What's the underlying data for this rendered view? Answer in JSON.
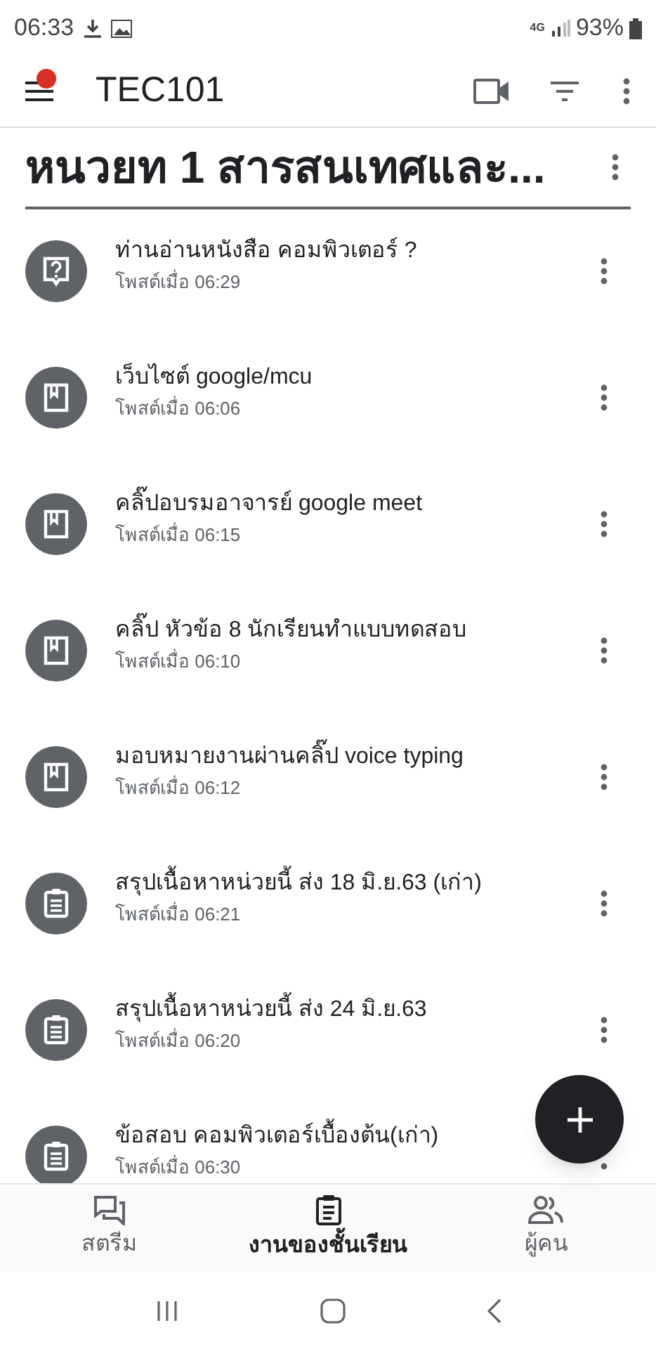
{
  "status_bar": {
    "time": "06:33",
    "network": "4G",
    "battery": "93%"
  },
  "app_bar": {
    "title": "TEC101",
    "menu_badge": true
  },
  "topic": {
    "title": "หนวยท 1 สารสนเทศและ..."
  },
  "items": [
    {
      "kind": "question",
      "title": "ท่านอ่านหนังสือ คอมพิวเตอร์ ?",
      "posted": "โพสต์เมื่อ 06:29"
    },
    {
      "kind": "material",
      "title": "เว็บไซต์ google/mcu",
      "posted": "โพสต์เมื่อ 06:06"
    },
    {
      "kind": "material",
      "title": "คลิ๊ปอบรมอาจารย์ google meet",
      "posted": "โพสต์เมื่อ 06:15"
    },
    {
      "kind": "material",
      "title": "คลิ๊ป หัวข้อ 8 นักเรียนทำแบบทดสอบ",
      "posted": "โพสต์เมื่อ 06:10"
    },
    {
      "kind": "material",
      "title": "มอบหมายงานผ่านคลิ๊ป voice typing",
      "posted": "โพสต์เมื่อ 06:12"
    },
    {
      "kind": "assignment",
      "title": "สรุปเนื้อหาหน่วยนี้ ส่ง 18 มิ.ย.63 (เก่า)",
      "posted": "โพสต์เมื่อ 06:21"
    },
    {
      "kind": "assignment",
      "title": "สรุปเนื้อหาหน่วยนี้ ส่ง 24 มิ.ย.63",
      "posted": "โพสต์เมื่อ 06:20"
    },
    {
      "kind": "assignment",
      "title": "ข้อสอบ คอมพิวเตอร์เบื้องต้น(เก่า)",
      "posted": "โพสต์เมื่อ 06:30"
    }
  ],
  "bottom_nav": [
    {
      "kind": "stream",
      "label": "สตรีม",
      "selected": false
    },
    {
      "kind": "classwork",
      "label": "งานของชั้นเรียน",
      "selected": true
    },
    {
      "kind": "people",
      "label": "ผู้คน",
      "selected": false
    }
  ]
}
